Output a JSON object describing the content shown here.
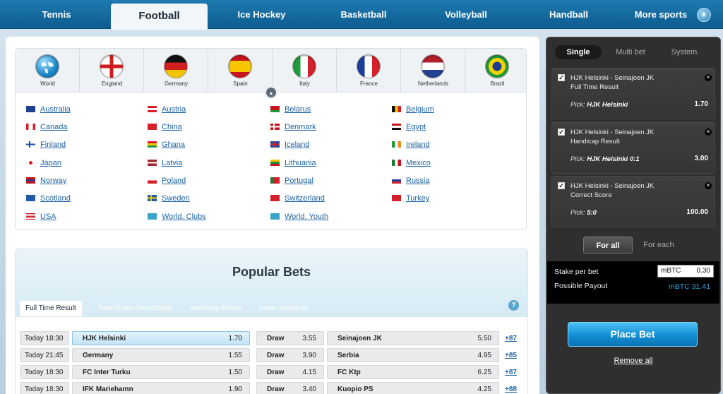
{
  "nav": {
    "tabs": [
      "Tennis",
      "Football",
      "Ice Hockey",
      "Basketball",
      "Volleyball",
      "Handball",
      "More sports"
    ],
    "active": "Football"
  },
  "flags": [
    {
      "label": "World",
      "icon": "world-globe-icon"
    },
    {
      "label": "England",
      "icon": "england-flag-icon"
    },
    {
      "label": "Germany",
      "icon": "germany-flag-icon"
    },
    {
      "label": "Spain",
      "icon": "spain-flag-icon"
    },
    {
      "label": "Italy",
      "icon": "italy-flag-icon"
    },
    {
      "label": "France",
      "icon": "france-flag-icon"
    },
    {
      "label": "Netherlands",
      "icon": "netherlands-flag-icon"
    },
    {
      "label": "Brazil",
      "icon": "brazil-flag-icon"
    }
  ],
  "countries": [
    [
      "Australia",
      "Austria",
      "Belarus",
      "Belgium"
    ],
    [
      "Canada",
      "China",
      "Denmark",
      "Egypt"
    ],
    [
      "Finland",
      "Ghana",
      "Iceland",
      "Ireland"
    ],
    [
      "Japan",
      "Latvia",
      "Lithuania",
      "Mexico"
    ],
    [
      "Norway",
      "Poland",
      "Portugal",
      "Russia"
    ],
    [
      "Scotland",
      "Sweden",
      "Switzerland",
      "Turkey"
    ],
    [
      "USA",
      "World. Clubs",
      "World. Youth",
      ""
    ]
  ],
  "popular": {
    "title": "Popular Bets",
    "tabs": [
      "Full Time Result",
      "Total Goals Over/Under",
      "Handicap Result",
      "Asian Handicap"
    ],
    "help": "?",
    "rows": [
      {
        "time": "Today 18:30",
        "home": "HJK Helsinki",
        "home_odds": "1.70",
        "draw": "Draw",
        "draw_odds": "3.55",
        "away": "Seinajoen JK",
        "away_odds": "5.50",
        "more": "+87"
      },
      {
        "time": "Today 21:45",
        "home": "Germany",
        "home_odds": "1.55",
        "draw": "Draw",
        "draw_odds": "3.90",
        "away": "Serbia",
        "away_odds": "4.95",
        "more": "+85"
      },
      {
        "time": "Today 18:30",
        "home": "FC Inter Turku",
        "home_odds": "1.50",
        "draw": "Draw",
        "draw_odds": "4.15",
        "away": "FC Ktp",
        "away_odds": "6.25",
        "more": "+87"
      },
      {
        "time": "Today 18:30",
        "home": "IFK Mariehamn",
        "home_odds": "1.90",
        "draw": "Draw",
        "draw_odds": "3.40",
        "away": "Kuopio PS",
        "away_odds": "4.25",
        "more": "+88"
      }
    ]
  },
  "betslip": {
    "tabs": [
      "Single",
      "Multi bet",
      "System"
    ],
    "items": [
      {
        "match": "HJK Helsinki - Seinajoen JK",
        "market": "Full Time Result",
        "pick_label": "Pick:",
        "pick": "HJK Helsinki",
        "odds": "1.70"
      },
      {
        "match": "HJK Helsinki - Seinajoen JK",
        "market": "Handicap Result",
        "pick_label": "Pick:",
        "pick": "HJK Helsinki 0:1",
        "odds": "3.00"
      },
      {
        "match": "HJK Helsinki - Seinajoen JK",
        "market": "Correct Score",
        "pick_label": "Pick:",
        "pick": "5:0",
        "odds": "100.00"
      }
    ],
    "stake_tabs": [
      "For all",
      "For each"
    ],
    "stake_label": "Stake per bet",
    "stake_unit": "mBTC",
    "stake_value": "0.30",
    "payout_label": "Possible Payout",
    "payout_value": "mBTC 31.41",
    "place_bet": "Place Bet",
    "remove_all": "Remove all"
  }
}
